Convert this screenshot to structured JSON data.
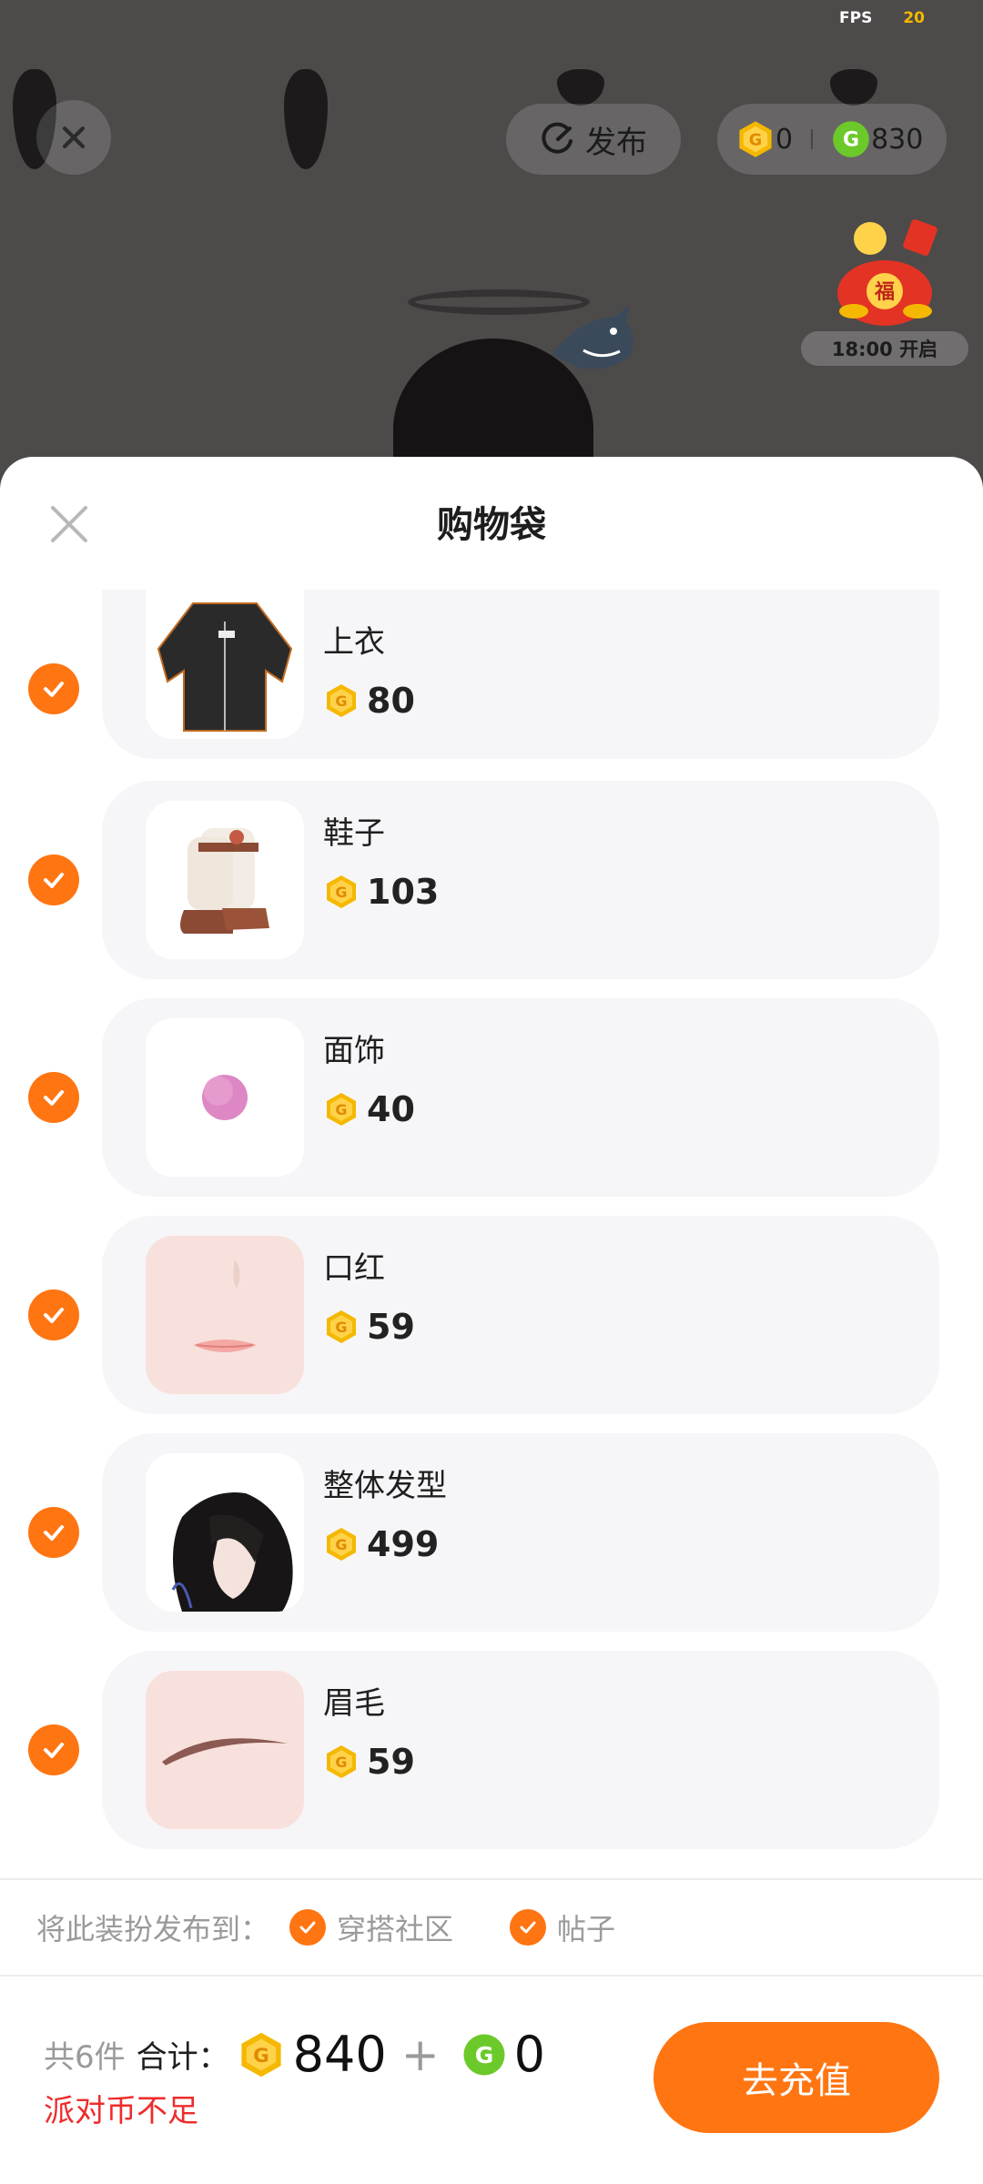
{
  "hud": {
    "fps_label": "FPS",
    "fps_value": "20",
    "publish_label": "发布",
    "gold_balance": "0",
    "green_balance": "830",
    "event_time": "18:00 开启"
  },
  "sheet": {
    "title": "购物袋",
    "items": [
      {
        "name": "上衣",
        "price": "80",
        "selected": true,
        "icon": "hoodie"
      },
      {
        "name": "鞋子",
        "price": "103",
        "selected": true,
        "icon": "boots"
      },
      {
        "name": "面饰",
        "price": "40",
        "selected": true,
        "icon": "pink-dot"
      },
      {
        "name": "口红",
        "price": "59",
        "selected": true,
        "icon": "lips"
      },
      {
        "name": "整体发型",
        "price": "499",
        "selected": true,
        "icon": "hairstyle"
      },
      {
        "name": "眉毛",
        "price": "59",
        "selected": true,
        "icon": "eyebrow"
      }
    ]
  },
  "publish_to": {
    "label": "将此装扮发布到：",
    "options": [
      {
        "label": "穿搭社区",
        "checked": true
      },
      {
        "label": "帖子",
        "checked": true
      }
    ]
  },
  "footer": {
    "count_label": "共6件",
    "sum_label": "合计：",
    "gold_total": "840",
    "plus": "+",
    "green_total": "0",
    "warning": "派对币不足",
    "recharge_label": "去充值"
  },
  "colors": {
    "accent": "#ff7512",
    "warning": "#ee2c2c",
    "gold_coin": "#f5b800",
    "green_coin": "#6cc92a"
  }
}
